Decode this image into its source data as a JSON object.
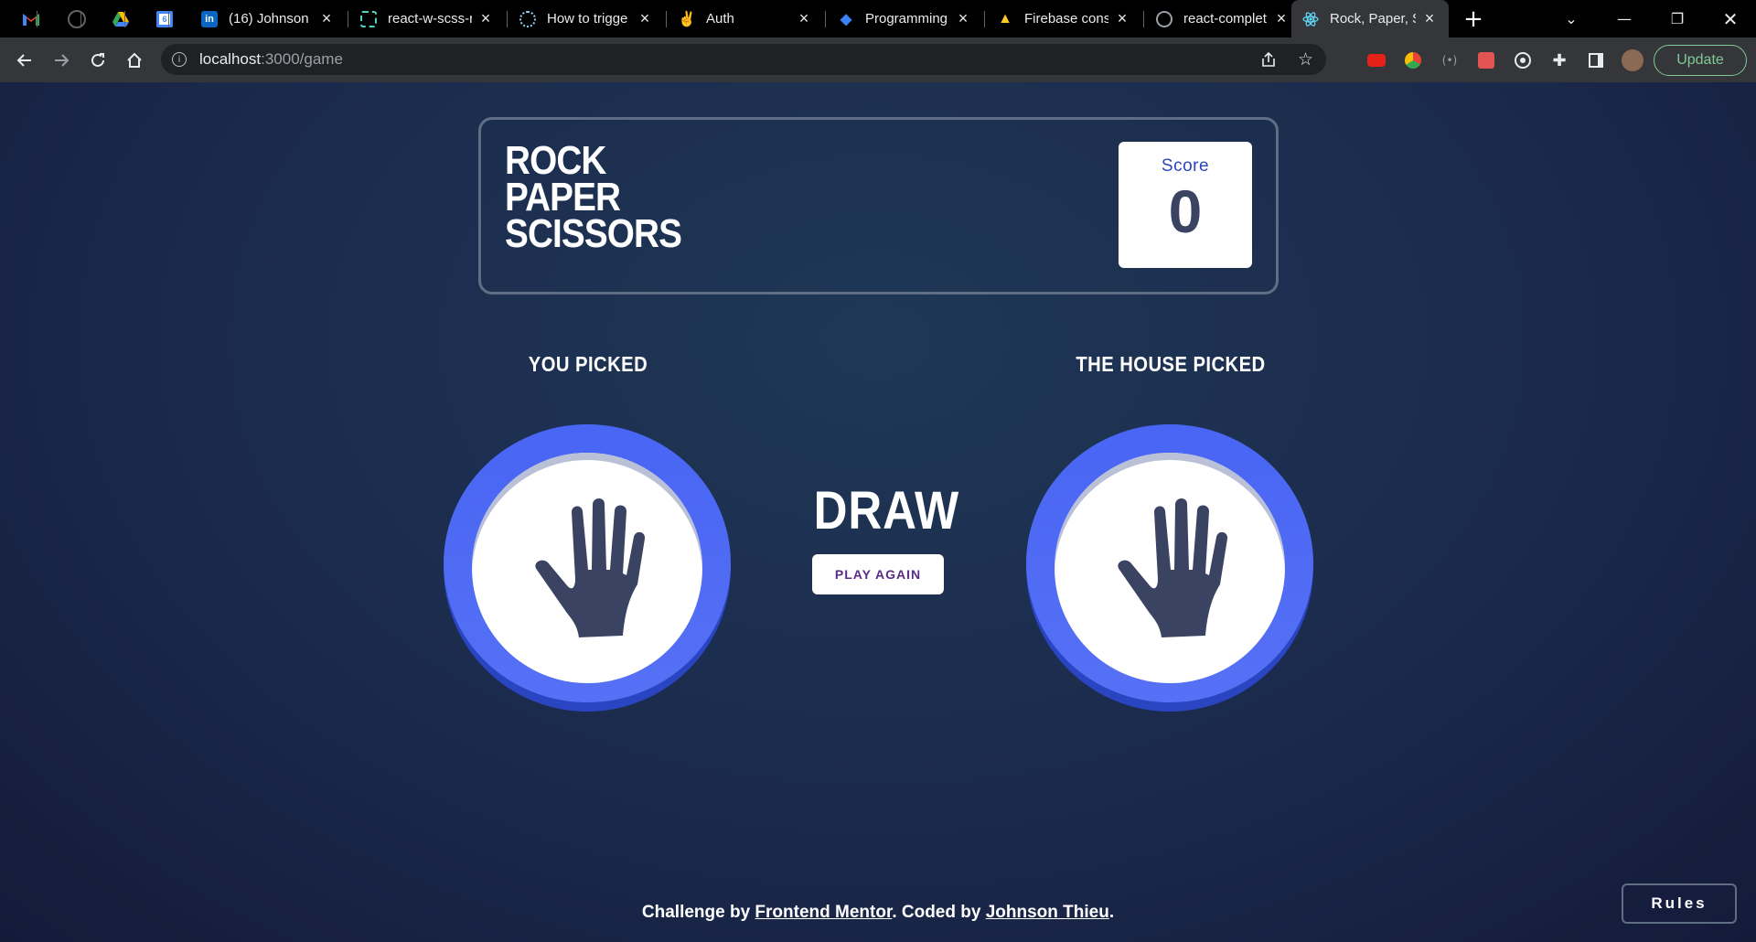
{
  "browser": {
    "tabs": [
      {
        "title": "(16) Johnson",
        "icon": "linkedin-icon",
        "color": "#0a66c2"
      },
      {
        "title": "react-w-scss-r",
        "icon": "codesandbox-icon",
        "color": "#4fd1c5"
      },
      {
        "title": "How to trigge",
        "icon": "webpack-icon",
        "color": "#8ed6fb"
      },
      {
        "title": "Auth",
        "icon": "auth0-icon",
        "color": "#f0ad4e"
      },
      {
        "title": "Programming",
        "icon": "layers-icon",
        "color": "#3b82f6"
      },
      {
        "title": "Firebase conso",
        "icon": "firebase-icon",
        "color": "#ffca28"
      },
      {
        "title": "react-complet",
        "icon": "github-icon",
        "color": "#9aa0a6"
      },
      {
        "title": "Rock, Paper, S",
        "icon": "react-icon",
        "color": "#61dafb",
        "active": true
      }
    ],
    "pinned_tabs": [
      "gmail-icon",
      "github-icon",
      "drive-icon",
      "calendar-icon"
    ],
    "url_host": "localhost",
    "url_path": ":3000/game",
    "update_label": "Update"
  },
  "header": {
    "title_lines": [
      "ROCK",
      "PAPER",
      "SCISSORS"
    ],
    "score_label": "Score",
    "score_value": "0"
  },
  "game": {
    "player_label": "YOU PICKED",
    "house_label": "THE HOUSE PICKED",
    "player_choice": "paper",
    "house_choice": "paper",
    "result": "DRAW",
    "play_again_label": "PLAY AGAIN"
  },
  "footer": {
    "prefix": "Challenge by ",
    "link1": "Frontend Mentor",
    "middle": ". Coded by ",
    "link2": "Johnson Thieu",
    "suffix": "."
  },
  "rules_label": "Rules",
  "colors": {
    "paper_ring": "#5671f5",
    "paper_shadow": "#2a45c2",
    "background": "#1f3756",
    "header_outline": "#606e85",
    "score_text": "#2a45c2",
    "dark_text": "#3b4363"
  }
}
